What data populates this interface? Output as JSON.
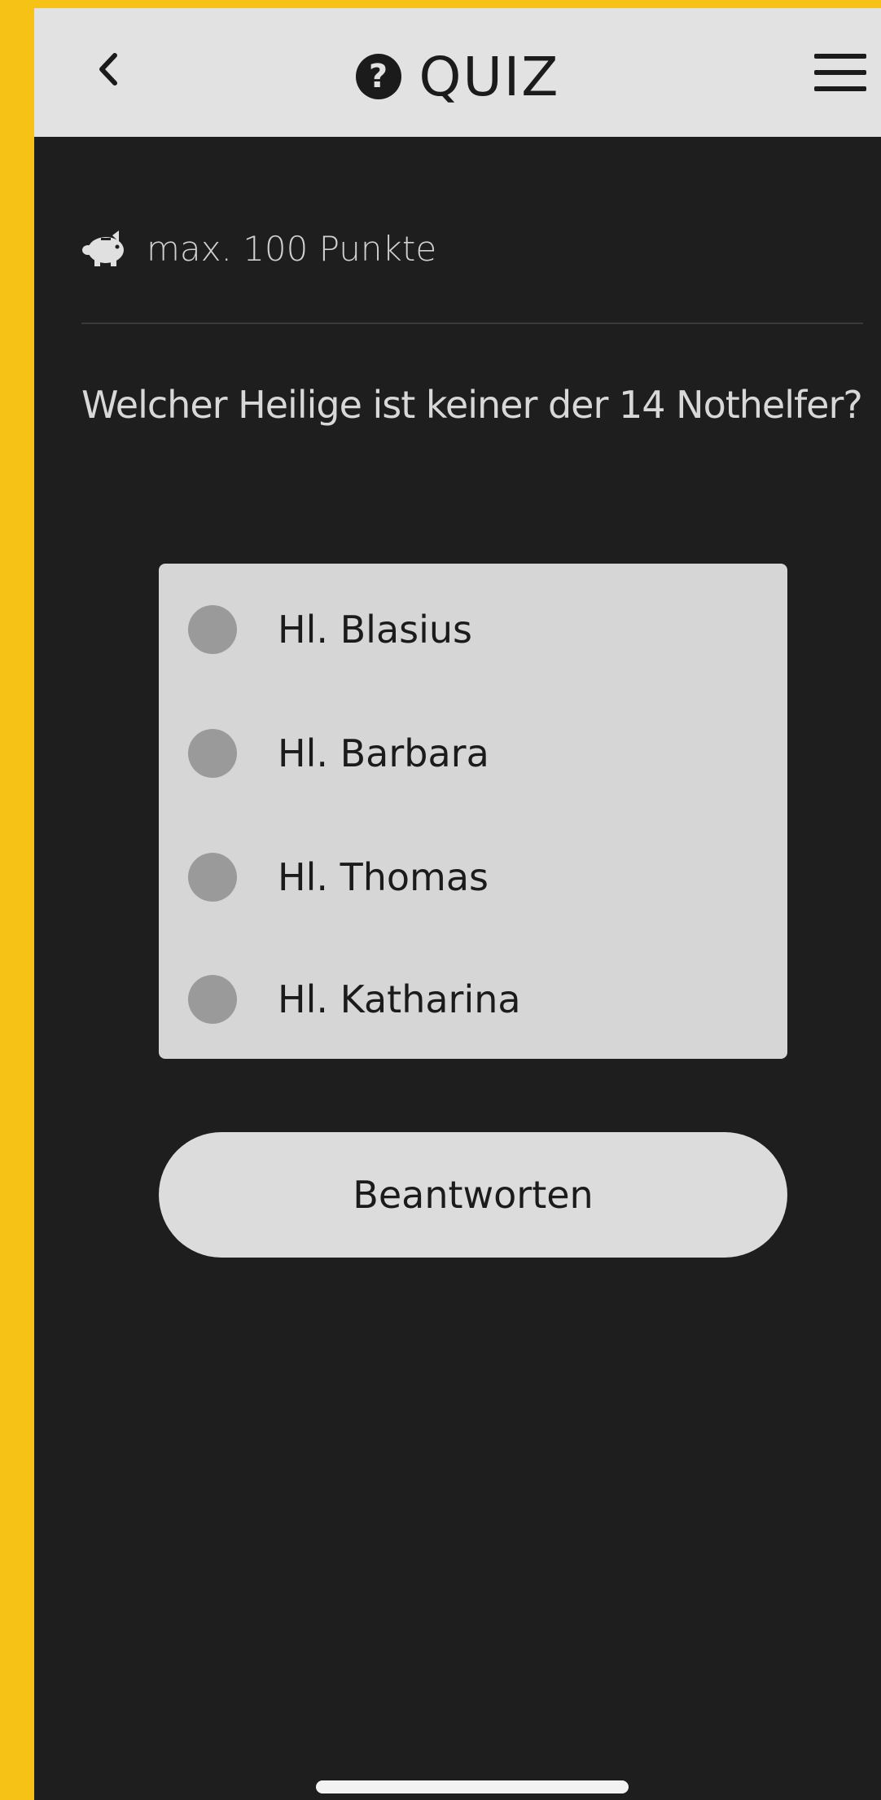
{
  "header": {
    "title": "QUIZ",
    "title_icon": "question-circle-icon",
    "back_icon": "chevron-left-icon",
    "menu_icon": "hamburger-menu-icon"
  },
  "points": {
    "icon": "piggy-bank-icon",
    "text": "max. 100 Punkte"
  },
  "question": "Welcher Heilige ist keiner der 14 Nothelfer?",
  "options": [
    {
      "label": "Hl. Blasius"
    },
    {
      "label": "Hl. Barbara"
    },
    {
      "label": "Hl. Thomas"
    },
    {
      "label": "Hl. Katharina"
    }
  ],
  "answer_button": "Beantworten",
  "colors": {
    "frame": "#f5c215",
    "background": "#1e1e1e",
    "appbar": "#e2e2e2",
    "radio": "#9a9a9a",
    "panel": "#d6d6d6"
  }
}
